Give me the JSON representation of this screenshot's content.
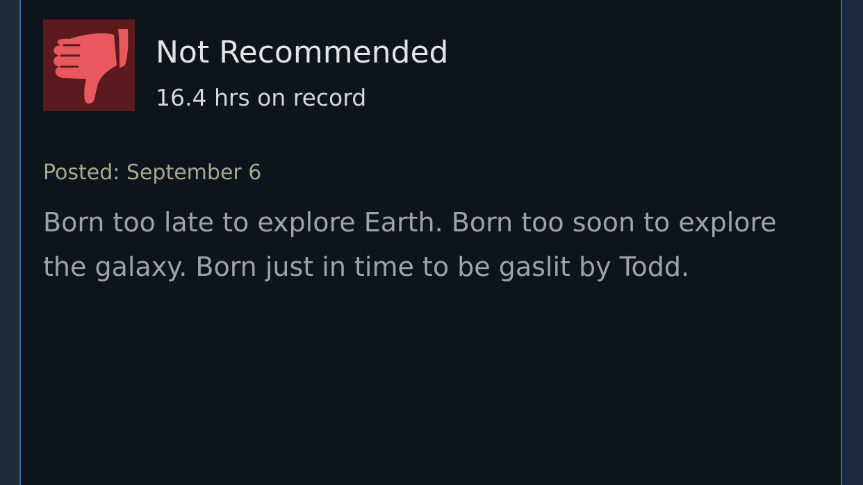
{
  "review": {
    "verdict": "Not Recommended",
    "hours": "16.4 hrs on record",
    "posted": "Posted: September 6",
    "body": "Born too late to explore Earth. Born too soon to explore the galaxy. Born just in time to be gaslit by Todd.",
    "icon": "thumbs-down-icon"
  },
  "colors": {
    "card_background": "#0e141c",
    "card_border": "#3d6e9c",
    "icon_background": "#5a1a1e",
    "icon_color": "#e8585c"
  }
}
